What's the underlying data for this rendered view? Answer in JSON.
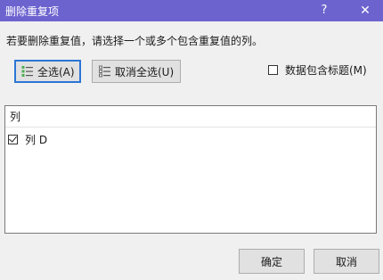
{
  "window": {
    "title": "删除重复项",
    "help": "?",
    "close": "✕"
  },
  "instruction": "若要删除重复值，请选择一个或多个包含重复值的列。",
  "buttons": {
    "select_all": "全选(A)",
    "unselect_all": "取消全选(U)",
    "ok": "确定",
    "cancel": "取消"
  },
  "header_checkbox": {
    "label": "数据包含标题(M)",
    "checked": false
  },
  "list": {
    "header": "列",
    "items": [
      {
        "label": "列 D",
        "checked": true
      }
    ]
  },
  "colors": {
    "titlebar": "#6d63cf",
    "focus_border": "#2b76d6",
    "dialog_bg": "#f0f0f0"
  }
}
